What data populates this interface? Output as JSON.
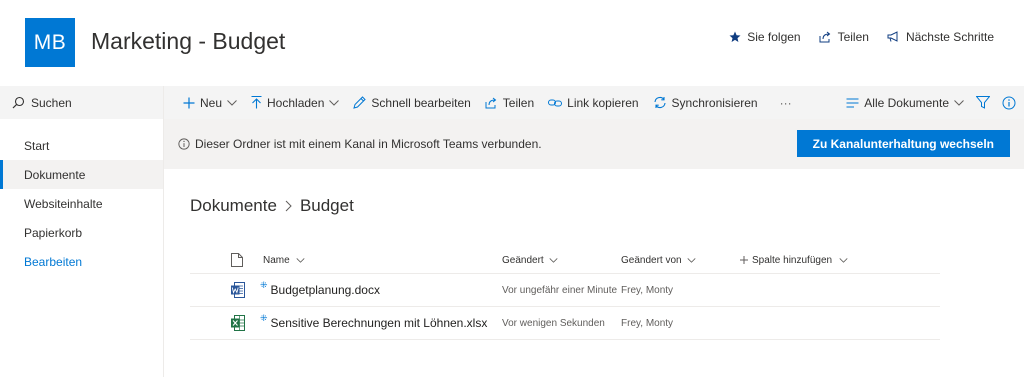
{
  "header": {
    "logo_text": "MB",
    "site_title": "Marketing - Budget",
    "actions": {
      "follow": "Sie folgen",
      "share": "Teilen",
      "next_steps": "Nächste Schritte"
    }
  },
  "leftnav": {
    "search": "Suchen",
    "items": [
      {
        "label": "Start"
      },
      {
        "label": "Dokumente"
      },
      {
        "label": "Websiteinhalte"
      },
      {
        "label": "Papierkorb"
      },
      {
        "label": "Bearbeiten"
      }
    ]
  },
  "commandbar": {
    "new": "Neu",
    "upload": "Hochladen",
    "quick_edit": "Schnell bearbeiten",
    "share": "Teilen",
    "copy_link": "Link kopieren",
    "sync": "Synchronisieren",
    "more": "···",
    "view": "Alle Dokumente"
  },
  "infobar": {
    "message": "Dieser Ordner ist mit einem Kanal in Microsoft Teams verbunden.",
    "button": "Zu Kanalunterhaltung wechseln"
  },
  "breadcrumb": {
    "root": "Dokumente",
    "current": "Budget"
  },
  "table": {
    "columns": {
      "name": "Name",
      "modified": "Geändert",
      "modified_by": "Geändert von",
      "add_column": "Spalte hinzufügen"
    },
    "rows": [
      {
        "type": "word-icon",
        "name": "Budgetplanung.docx",
        "modified": "Vor ungefähr einer Minute",
        "modified_by": "Frey, Monty"
      },
      {
        "type": "excel-icon",
        "name": "Sensitive Berechnungen mit Löhnen.xlsx",
        "modified": "Vor wenigen Sekunden",
        "modified_by": "Frey, Monty"
      }
    ]
  },
  "colors": {
    "accent": "#0078d4",
    "word": "#2b579a",
    "excel": "#217346"
  }
}
